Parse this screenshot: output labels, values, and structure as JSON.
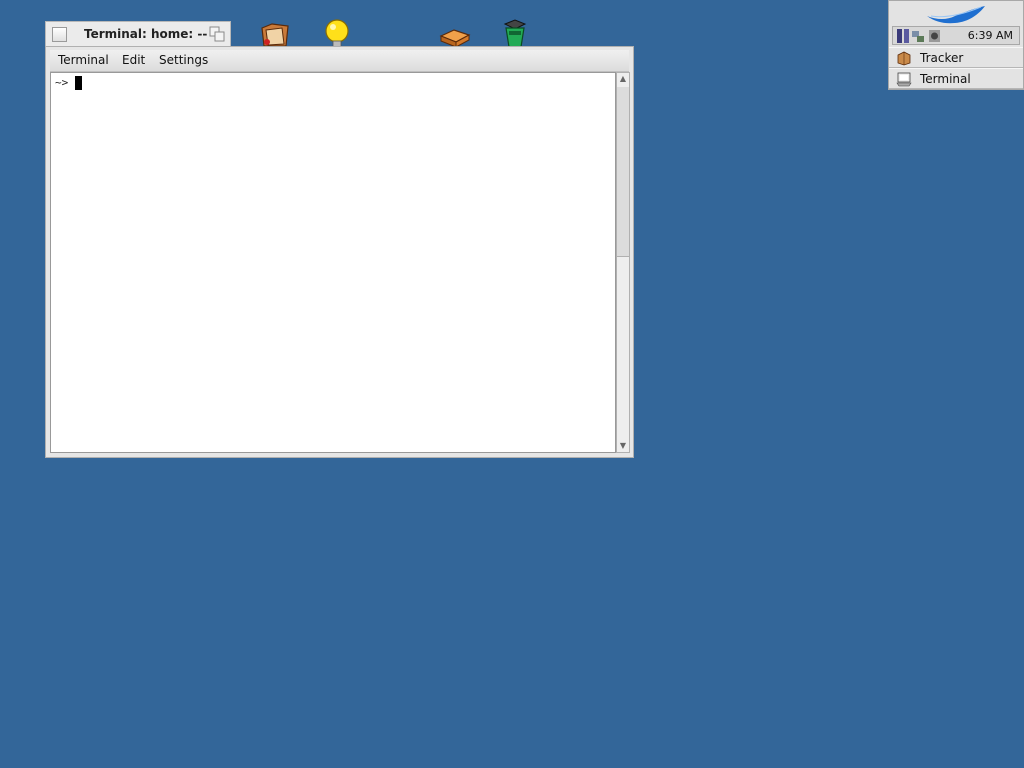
{
  "desktop": {
    "background_color": "#336699",
    "icons": [
      "home-folder-icon",
      "lightbulb-icon",
      "disk-icon",
      "trash-icon"
    ]
  },
  "terminal_window": {
    "title": "Terminal: home: --",
    "menu": [
      "Terminal",
      "Edit",
      "Settings"
    ],
    "prompt": "~>"
  },
  "deskbar": {
    "clock": "6:39 AM",
    "apps": [
      {
        "label": "Tracker",
        "icon": "tracker-icon"
      },
      {
        "label": "Terminal",
        "icon": "terminal-icon"
      }
    ]
  }
}
